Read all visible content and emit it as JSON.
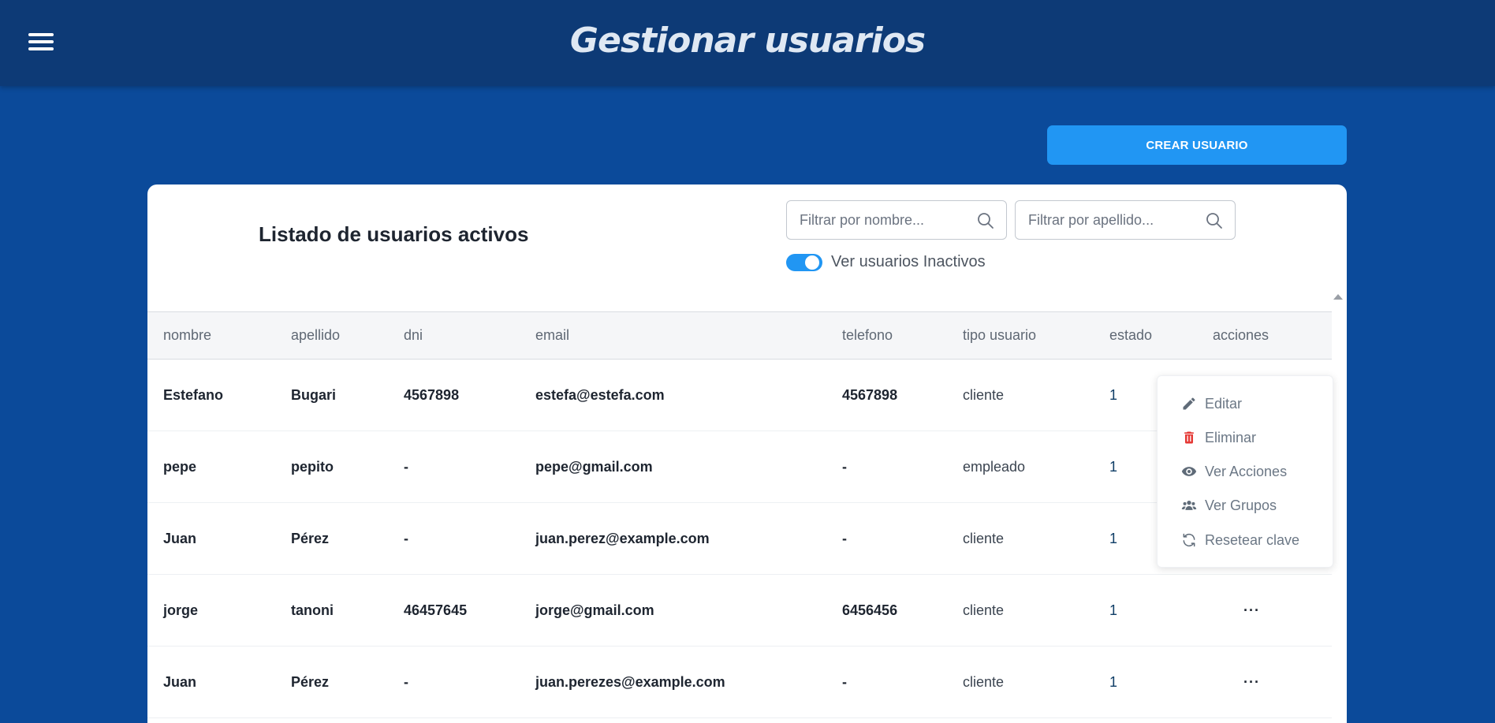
{
  "header": {
    "title": "Gestionar usuarios"
  },
  "toolbar": {
    "create_label": "CREAR USUARIO"
  },
  "card": {
    "title": "Listado de usuarios activos",
    "filter_nombre_placeholder": "Filtrar por nombre...",
    "filter_apellido_placeholder": "Filtrar por apellido...",
    "toggle_label": "Ver usuarios Inactivos",
    "toggle_on": true
  },
  "table": {
    "headers": {
      "nombre": "nombre",
      "apellido": "apellido",
      "dni": "dni",
      "email": "email",
      "telefono": "telefono",
      "tipo": "tipo usuario",
      "estado": "estado",
      "acciones": "acciones"
    },
    "rows": [
      {
        "nombre": "Estefano",
        "apellido": "Bugari",
        "dni": "4567898",
        "email": "estefa@estefa.com",
        "telefono": "4567898",
        "tipo": "cliente",
        "estado": "1",
        "acciones": "···"
      },
      {
        "nombre": "pepe",
        "apellido": "pepito",
        "dni": "-",
        "email": "pepe@gmail.com",
        "telefono": "-",
        "tipo": "empleado",
        "estado": "1",
        "acciones": "···"
      },
      {
        "nombre": "Juan",
        "apellido": "Pérez",
        "dni": "-",
        "email": "juan.perez@example.com",
        "telefono": "-",
        "tipo": "cliente",
        "estado": "1",
        "acciones": "···"
      },
      {
        "nombre": "jorge",
        "apellido": "tanoni",
        "dni": "46457645",
        "email": "jorge@gmail.com",
        "telefono": "6456456",
        "tipo": "cliente",
        "estado": "1",
        "acciones": "···"
      },
      {
        "nombre": "Juan",
        "apellido": "Pérez",
        "dni": "-",
        "email": "juan.perezes@example.com",
        "telefono": "-",
        "tipo": "cliente",
        "estado": "1",
        "acciones": "···"
      }
    ]
  },
  "actions_menu": {
    "items": [
      {
        "label": "Editar",
        "icon": "pencil-icon",
        "color": "#6b7785"
      },
      {
        "label": "Eliminar",
        "icon": "trash-icon",
        "color": "#e53935"
      },
      {
        "label": "Ver Acciones",
        "icon": "eye-icon",
        "color": "#6b7785"
      },
      {
        "label": "Ver Grupos",
        "icon": "users-icon",
        "color": "#6b7785"
      },
      {
        "label": "Resetear clave",
        "icon": "refresh-icon",
        "color": "#6b7785"
      }
    ]
  },
  "colors": {
    "background": "#0b4a9a",
    "topbar": "#0d3a76",
    "accent": "#2196f3",
    "danger": "#e53935"
  }
}
